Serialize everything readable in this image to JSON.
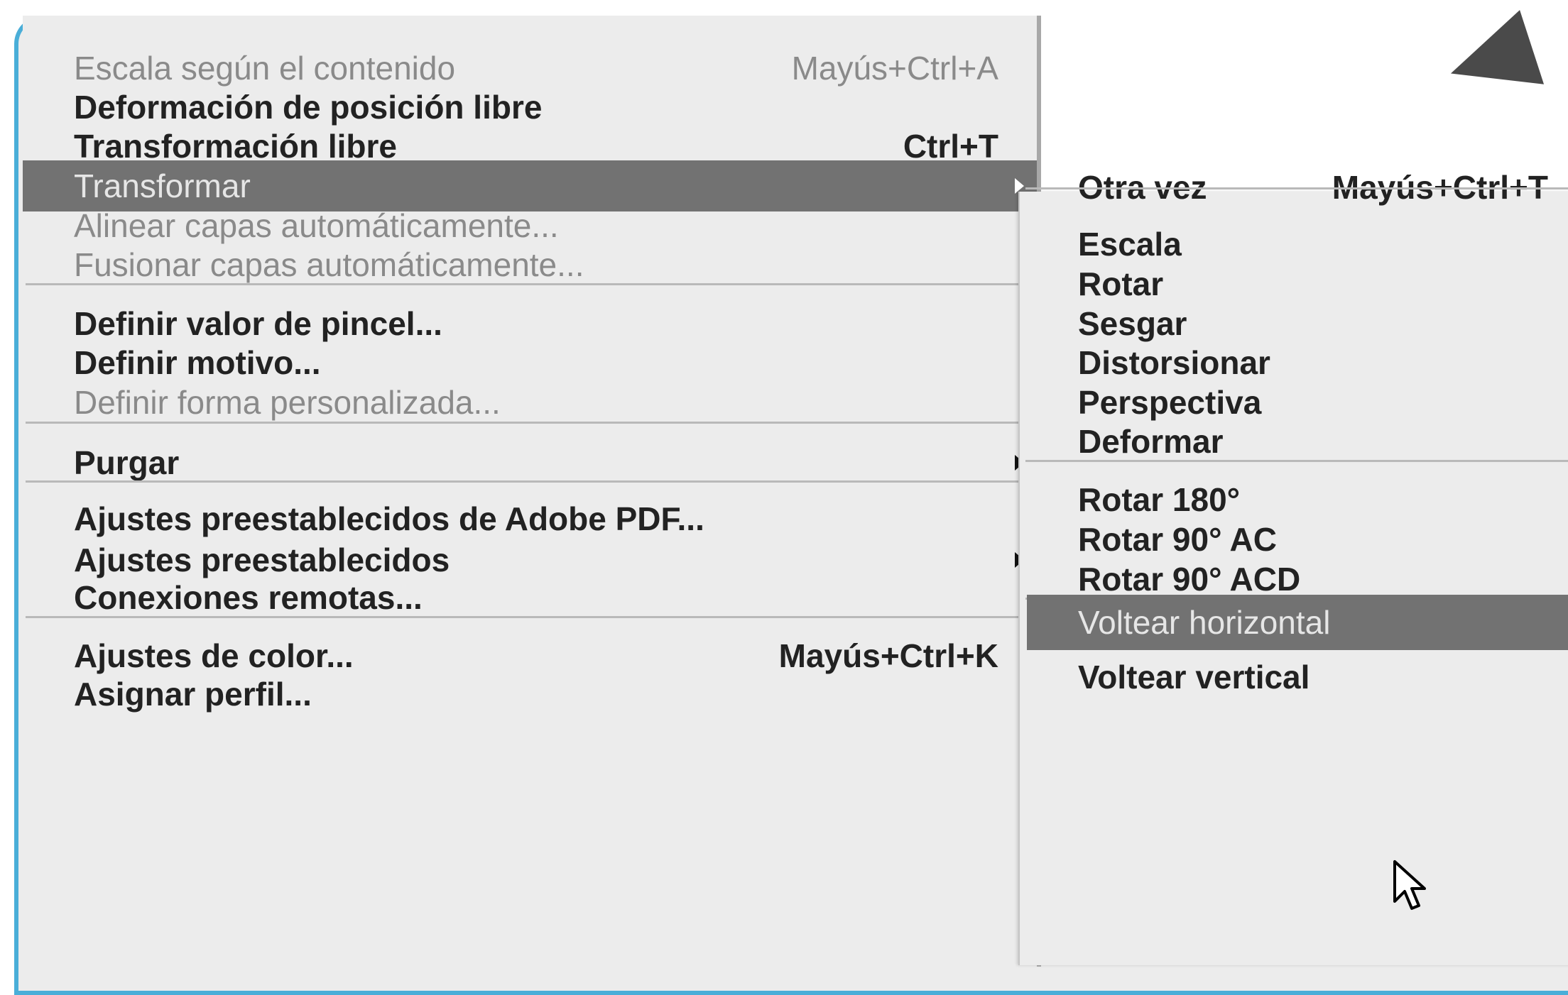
{
  "main_menu": {
    "items": [
      {
        "label": "Escala según el contenido",
        "shortcut": "Mayús+Ctrl+A",
        "state": "disabled"
      },
      {
        "label": "Deformación de posición libre",
        "shortcut": "",
        "state": "enabled"
      },
      {
        "label": "Transformación libre",
        "shortcut": "Ctrl+T",
        "state": "enabled"
      },
      {
        "label": "Transformar",
        "shortcut": "",
        "state": "highlighted",
        "submenu": true
      },
      {
        "label": "Alinear capas automáticamente...",
        "shortcut": "",
        "state": "disabled"
      },
      {
        "label": "Fusionar capas automáticamente...",
        "shortcut": "",
        "state": "disabled"
      },
      {
        "label": "Definir valor de pincel...",
        "shortcut": "",
        "state": "enabled"
      },
      {
        "label": "Definir motivo...",
        "shortcut": "",
        "state": "enabled"
      },
      {
        "label": "Definir forma personalizada...",
        "shortcut": "",
        "state": "disabled"
      },
      {
        "label": "Purgar",
        "shortcut": "",
        "state": "enabled",
        "submenu": true
      },
      {
        "label": "Ajustes preestablecidos de Adobe PDF...",
        "shortcut": "",
        "state": "enabled"
      },
      {
        "label": "Ajustes preestablecidos",
        "shortcut": "",
        "state": "enabled",
        "submenu": true
      },
      {
        "label": "Conexiones remotas...",
        "shortcut": "",
        "state": "enabled"
      },
      {
        "label": "Ajustes de color...",
        "shortcut": "Mayús+Ctrl+K",
        "state": "enabled"
      },
      {
        "label": "Asignar perfil...",
        "shortcut": "",
        "state": "enabled"
      }
    ]
  },
  "transform_submenu": {
    "items": [
      {
        "label": "Otra vez",
        "shortcut": "Mayús+Ctrl+T",
        "state": "enabled"
      },
      {
        "label": "Escala",
        "shortcut": "",
        "state": "enabled"
      },
      {
        "label": "Rotar",
        "shortcut": "",
        "state": "enabled"
      },
      {
        "label": "Sesgar",
        "shortcut": "",
        "state": "enabled"
      },
      {
        "label": "Distorsionar",
        "shortcut": "",
        "state": "enabled"
      },
      {
        "label": "Perspectiva",
        "shortcut": "",
        "state": "enabled"
      },
      {
        "label": "Deformar",
        "shortcut": "",
        "state": "enabled"
      },
      {
        "label": "Rotar 180°",
        "shortcut": "",
        "state": "enabled"
      },
      {
        "label": "Rotar 90° AC",
        "shortcut": "",
        "state": "enabled"
      },
      {
        "label": "Rotar 90° ACD",
        "shortcut": "",
        "state": "enabled"
      },
      {
        "label": "Voltear horizontal",
        "shortcut": "",
        "state": "highlighted"
      },
      {
        "label": "Voltear vertical",
        "shortcut": "",
        "state": "enabled"
      }
    ]
  },
  "colors": {
    "frame_border": "#4aaed8",
    "menu_bg": "#ececec",
    "highlight_bg": "#727272",
    "disabled_text": "#8a8a8a"
  },
  "icons": {
    "submenu_arrow": "triangle-right",
    "cursor": "mouse-pointer"
  }
}
